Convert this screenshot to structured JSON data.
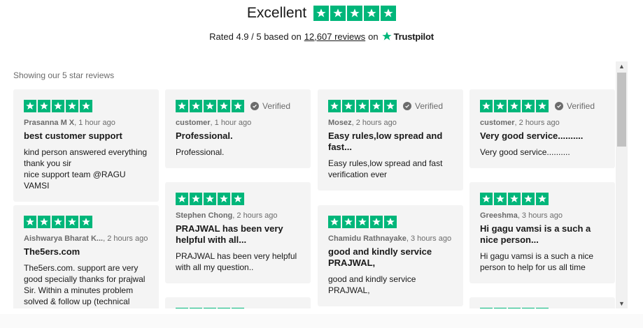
{
  "header": {
    "rating_word": "Excellent",
    "rated_prefix": "Rated 4.9 / 5 based on",
    "reviews_count": "12,607 reviews",
    "on_word": "on",
    "brand": "Trustpilot",
    "stars": 5
  },
  "showing_label": "Showing our 5 star reviews",
  "verified_label": "Verified",
  "colors": {
    "star_green": "#00b67a",
    "card_bg": "#f4f4f4"
  },
  "reviews": [
    {
      "author": "Prasanna M X",
      "time": "1 hour ago",
      "verified": false,
      "title": "best customer support",
      "body": "kind person answered everything thank you sir\nnice support team @RAGU VAMSI"
    },
    {
      "author": "Aishwarya Bharat K...",
      "time": "2 hours ago",
      "verified": false,
      "title": "The5ers.com",
      "body": "The5ers.com. support are very good specially thanks for prajwal Sir. Within a minutes problem solved & follow up (technical"
    },
    {
      "author": "customer",
      "time": "1 hour ago",
      "verified": true,
      "title": "Professional.",
      "body": "Professional."
    },
    {
      "author": "Stephen Chong",
      "time": "2 hours ago",
      "verified": false,
      "title": "PRAJWAL has been very helpful with all...",
      "body": "PRAJWAL has been very helpful with all my question.."
    },
    {
      "author": "Mosez",
      "time": "2 hours ago",
      "verified": true,
      "title": "Easy rules,low spread and fast...",
      "body": "Easy rules,low spread and fast verification ever"
    },
    {
      "author": "Chamidu Rathnayake",
      "time": "3 hours ago",
      "verified": false,
      "title": "good and kindly service PRAJWAL,",
      "body": "good and kindly service\nPRAJWAL,"
    },
    {
      "author": "customer",
      "time": "2 hours ago",
      "verified": true,
      "title": "Very good service..........",
      "body": "Very good service.........."
    },
    {
      "author": "Greeshma",
      "time": "3 hours ago",
      "verified": false,
      "title": "Hi gagu vamsi is a such a nice person...",
      "body": "Hi gagu vamsi is a such a nice person to help for us all time"
    }
  ]
}
